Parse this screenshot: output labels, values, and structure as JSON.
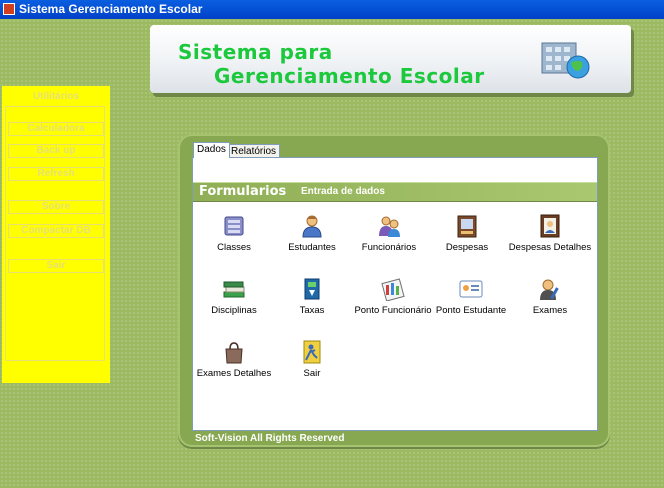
{
  "window": {
    "title": "Sistema Gerenciamento Escolar"
  },
  "banner": {
    "line1": "Sistema para",
    "line2": "Gerenciamento Escolar"
  },
  "sidebar": {
    "title": "Utilitários",
    "buttons": [
      {
        "label": "Calculadora"
      },
      {
        "label": "Back up"
      },
      {
        "label": "Refresh"
      },
      {
        "label": "Sobre"
      },
      {
        "label": "Compactar DB"
      },
      {
        "label": "Sair"
      }
    ]
  },
  "tabs": [
    {
      "label": "Dados",
      "active": true
    },
    {
      "label": "Relatórios",
      "active": false
    }
  ],
  "section": {
    "title": "Formularios",
    "subtitle": "Entrada de dados"
  },
  "items": [
    {
      "label": "Classes",
      "icon": "classes-icon"
    },
    {
      "label": "Estudantes",
      "icon": "student-icon"
    },
    {
      "label": "Funcionários",
      "icon": "employees-icon"
    },
    {
      "label": "Despesas",
      "icon": "expenses-icon"
    },
    {
      "label": "Despesas Detalhes",
      "icon": "expense-details-icon"
    },
    {
      "label": "Disciplinas",
      "icon": "books-icon"
    },
    {
      "label": "Taxas",
      "icon": "fees-icon"
    },
    {
      "label": "Ponto Funcionário",
      "icon": "employee-attendance-icon"
    },
    {
      "label": "Ponto Estudante",
      "icon": "student-attendance-icon"
    },
    {
      "label": "Exames",
      "icon": "exams-icon"
    },
    {
      "label": "Exames Detalhes",
      "icon": "bag-icon"
    },
    {
      "label": "Sair",
      "icon": "exit-icon"
    }
  ],
  "footer": {
    "text": "Soft-Vision All Rights Reserved"
  }
}
